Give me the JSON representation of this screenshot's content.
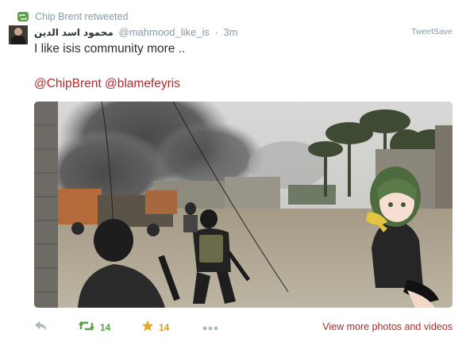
{
  "retweet_header": {
    "icon": "retweet-icon",
    "text": "Chip Brent retweeted"
  },
  "author": {
    "avatar": "avatar",
    "fullname": "محمود اسد الدين",
    "handle": "@mahmood_like_is",
    "separator": "·",
    "time": "3m"
  },
  "source": "TweetSave",
  "tweet": {
    "text": "I like isis community more ..",
    "mentions": [
      "@ChipBrent",
      "@blamefeyris"
    ]
  },
  "media": {
    "type": "photo"
  },
  "actions": {
    "reply_icon": "reply-icon",
    "retweet_icon": "retweet-icon",
    "retweet_count": "14",
    "favorite_icon": "star-icon",
    "favorite_count": "14",
    "more_icon": "more-icon",
    "view_more": "View more photos and videos"
  },
  "colors": {
    "link": "#b5282b",
    "retweet_green": "#5c9f48",
    "favorite_gold": "#d59a1f",
    "muted": "#8899a6"
  }
}
